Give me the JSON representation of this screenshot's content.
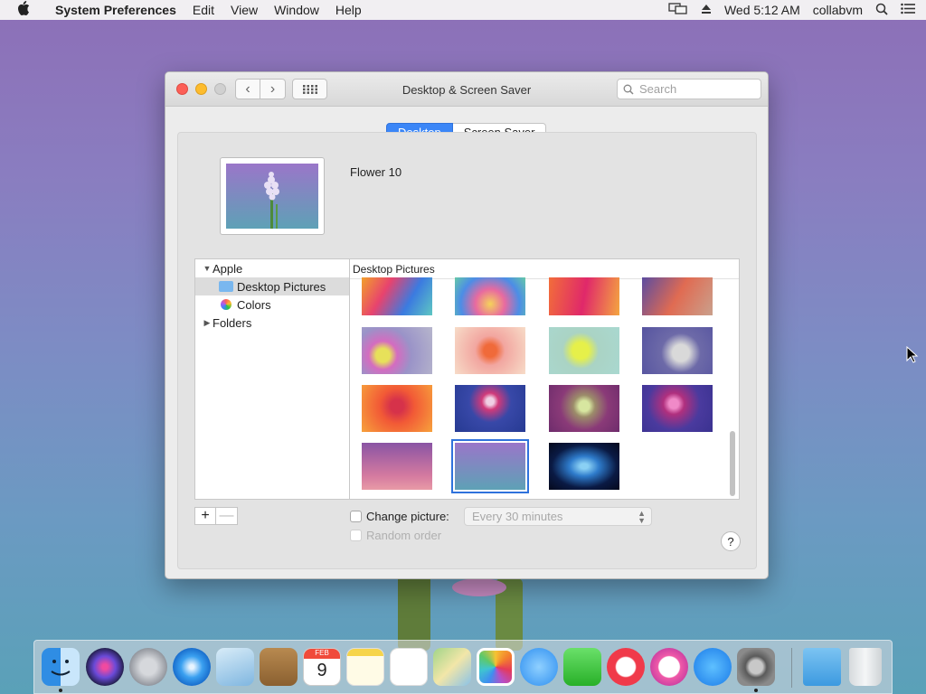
{
  "menubar": {
    "app_name": "System Preferences",
    "items": [
      "Edit",
      "View",
      "Window",
      "Help"
    ],
    "clock": "Wed 5:12 AM",
    "user": "collabvm"
  },
  "window": {
    "title": "Desktop & Screen Saver",
    "search_placeholder": "Search",
    "tabs": [
      "Desktop",
      "Screen Saver"
    ],
    "active_tab": "Desktop",
    "current_picture": "Flower 10",
    "sidebar": {
      "apple": "Apple",
      "desktop_pictures": "Desktop Pictures",
      "colors": "Colors",
      "folders": "Folders"
    },
    "gallery_title": "Desktop Pictures",
    "change_picture_label": "Change picture:",
    "interval": "Every 30 minutes",
    "random_order_label": "Random order",
    "help_label": "?"
  },
  "dock": {
    "apps": [
      "finder-icon",
      "siri-icon",
      "launchpad-icon",
      "safari-icon",
      "mail-icon",
      "contacts-icon",
      "calendar-icon",
      "notes-icon",
      "reminders-icon",
      "maps-icon",
      "photos-icon",
      "messages-icon",
      "facetime-icon",
      "news-icon",
      "itunes-icon",
      "app-store-icon",
      "system-preferences-icon",
      "downloads-icon",
      "trash-icon"
    ],
    "calendar_month": "FEB",
    "calendar_day": "9"
  }
}
